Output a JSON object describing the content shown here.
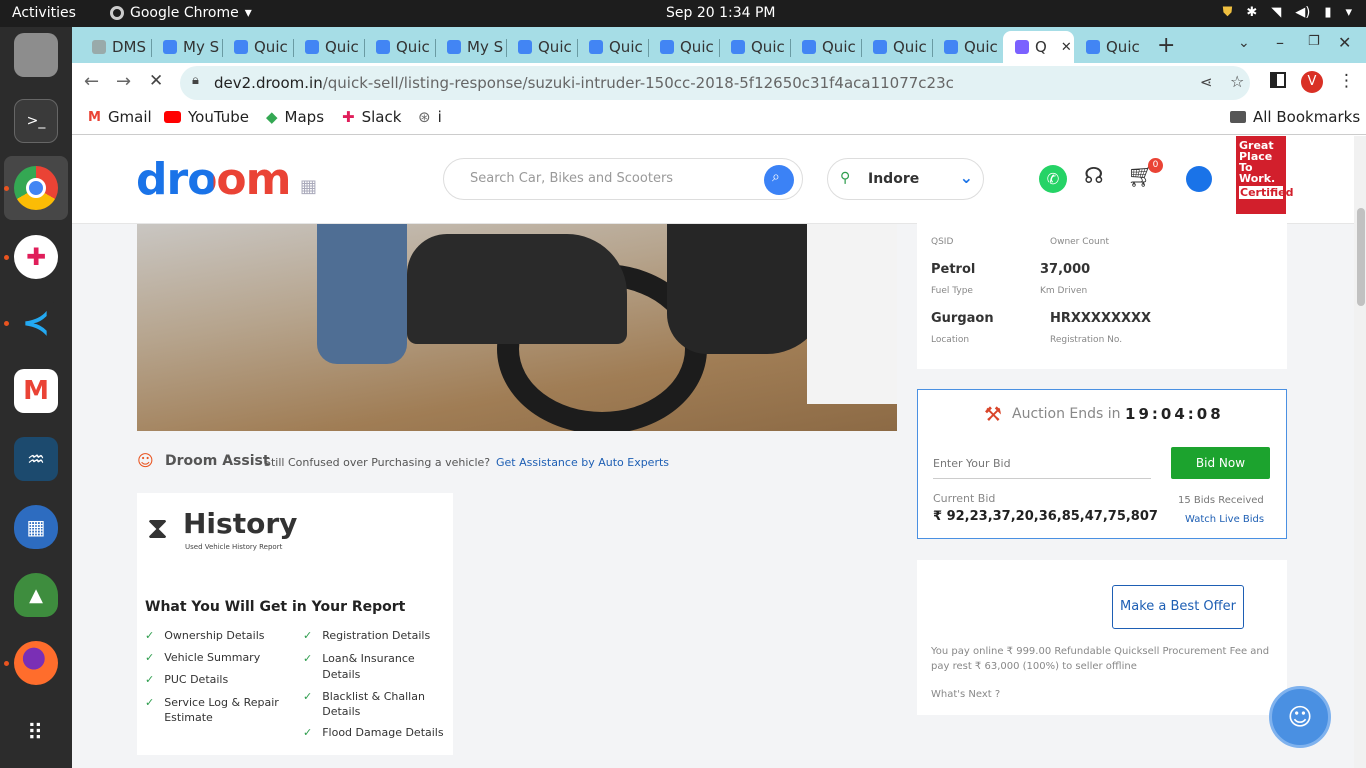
{
  "system": {
    "activities": "Activities",
    "app_name": "Google Chrome",
    "clock": "Sep 20  1:34 PM"
  },
  "tabs": [
    {
      "label": "DMS"
    },
    {
      "label": "My S"
    },
    {
      "label": "Quic"
    },
    {
      "label": "Quic"
    },
    {
      "label": "Quic"
    },
    {
      "label": "My S"
    },
    {
      "label": "Quic"
    },
    {
      "label": "Quic"
    },
    {
      "label": "Quic"
    },
    {
      "label": "Quic"
    },
    {
      "label": "Quic"
    },
    {
      "label": "Quic"
    },
    {
      "label": "Quic"
    },
    {
      "label": "Q",
      "active": true
    },
    {
      "label": "Quic"
    }
  ],
  "address_bar": {
    "domain": "dev2.droom.in",
    "path": "/quick-sell/listing-response/suzuki-intruder-150cc-2018-5f12650c31f4aca11077c23c",
    "profile_initial": "V"
  },
  "bookmarks": {
    "items": [
      "Gmail",
      "YouTube",
      "Maps",
      "Slack",
      "i"
    ],
    "all": "All Bookmarks"
  },
  "header": {
    "logo": "droom",
    "search_placeholder": "Search Car, Bikes and Scooters",
    "location": "Indore",
    "cart_count": "0",
    "badge_lines": [
      "Great",
      "Place",
      "To",
      "Work.",
      "Certified"
    ]
  },
  "vehicle_details": [
    {
      "value": "Petrol",
      "label": "Fuel Type"
    },
    {
      "value": "37,000",
      "label": "Km Driven"
    },
    {
      "value": "Gurgaon",
      "label": "Location"
    },
    {
      "value": "HRXXXXXXXX",
      "label": "Registration No."
    }
  ],
  "partial_row": {
    "label1": "QSID",
    "label2": "Owner Count"
  },
  "auction": {
    "label": "Auction Ends in",
    "timer": [
      "1",
      "9",
      "0",
      "4",
      "0",
      "8"
    ],
    "bid_placeholder": "Enter Your Bid",
    "bid_button": "Bid Now",
    "current_bid_label": "Current Bid",
    "current_bid": "₹ 92,23,37,20,36,85,47,75,807",
    "bids_received": "15 Bids Received",
    "watch_live": "Watch Live Bids"
  },
  "offer": {
    "button": "Make a Best Offer",
    "note": "You pay online ₹ 999.00 Refundable Quicksell Procurement Fee and pay rest ₹ 63,000 (100%) to seller offline",
    "whats_next": "What's Next ?"
  },
  "assist": {
    "title": "Droom Assist",
    "text": "Still Confused over Purchasing a vehicle?",
    "link": "Get Assistance by Auto Experts"
  },
  "history": {
    "title": "History",
    "subtitle": "Used Vehicle History Report",
    "heading": "What You Will Get in Your Report",
    "left": [
      "Ownership Details",
      "Vehicle Summary",
      "PUC Details",
      "Service Log & Repair Estimate"
    ],
    "right": [
      "Registration Details",
      "Loan& Insurance Details",
      "Blacklist & Challan Details",
      "Flood Damage Details"
    ]
  },
  "colors": {
    "tab_strip": "#a6dde6",
    "droom_blue": "#1a73e8",
    "bid_green": "#1ca32e",
    "link_blue": "#1e5fb4"
  }
}
